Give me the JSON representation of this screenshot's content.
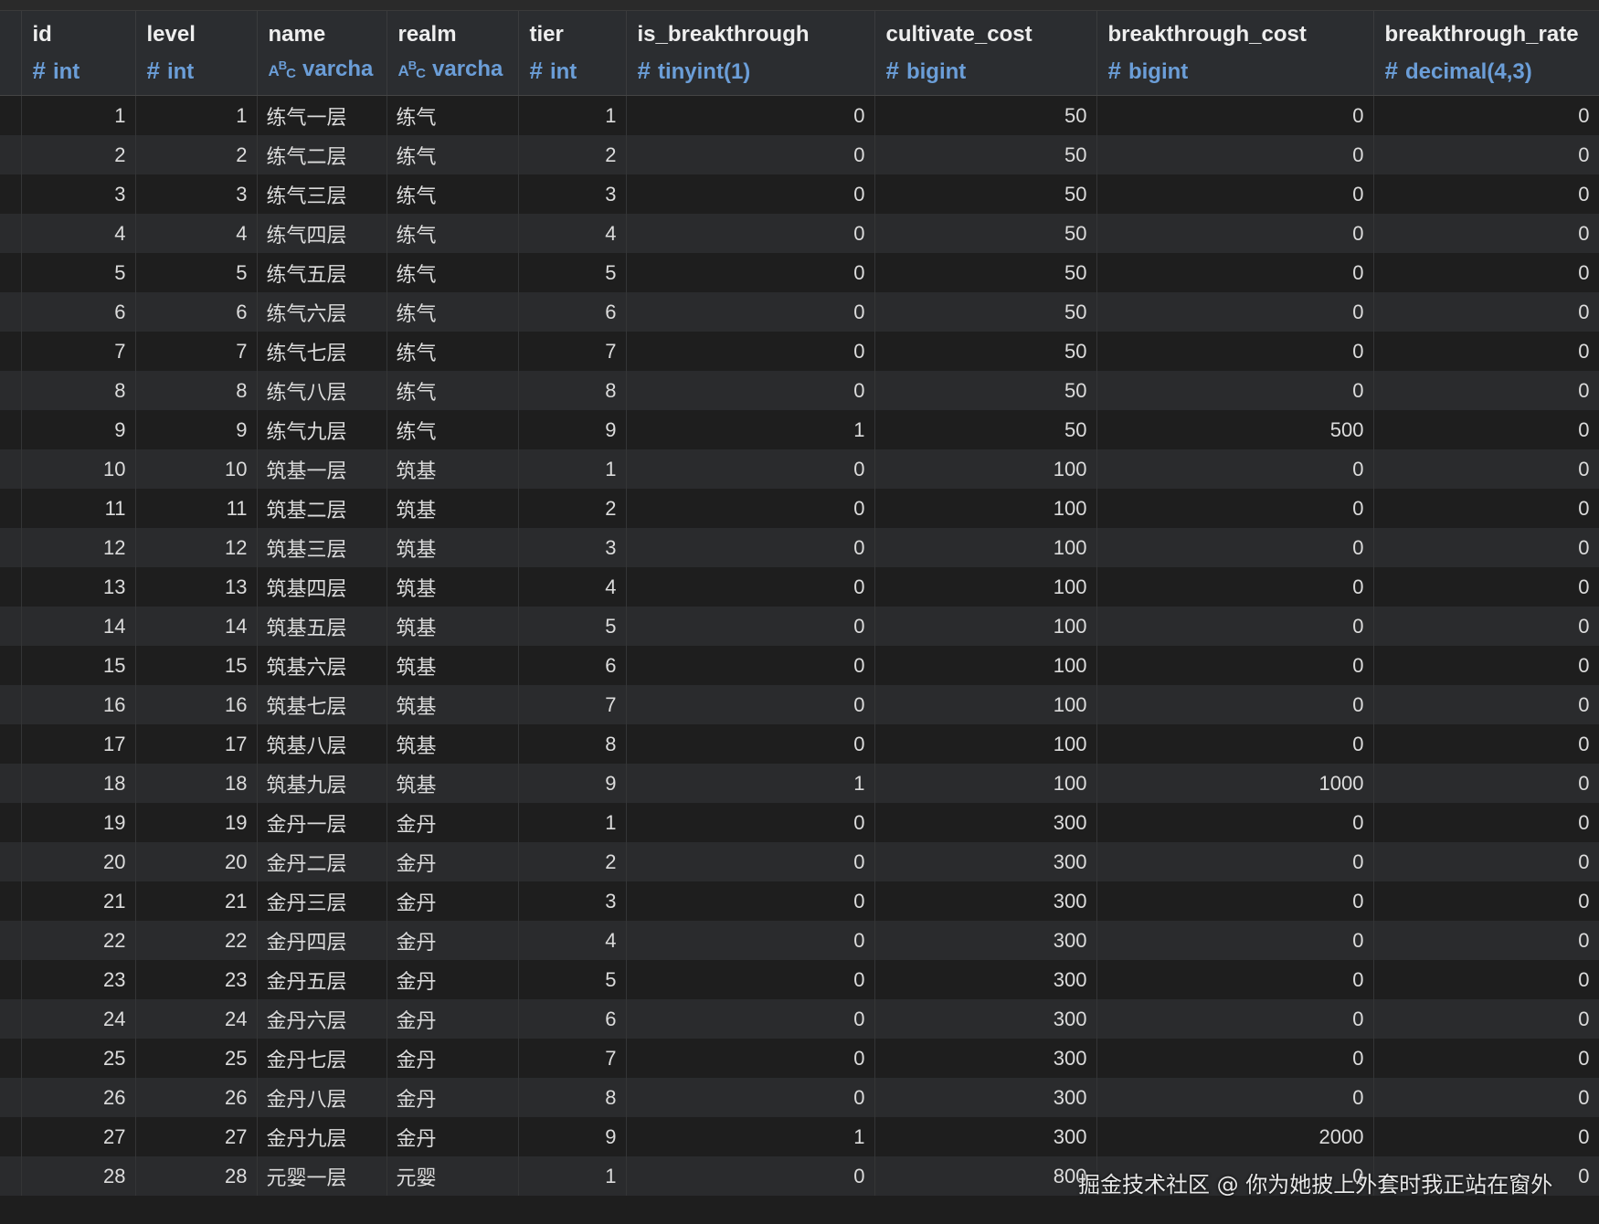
{
  "columns": [
    {
      "name": "id",
      "type": "int",
      "icon": "hash-icon"
    },
    {
      "name": "level",
      "type": "int",
      "icon": "hash-icon"
    },
    {
      "name": "name",
      "type": "varcha",
      "icon": "abc-icon"
    },
    {
      "name": "realm",
      "type": "varcha",
      "icon": "abc-icon"
    },
    {
      "name": "tier",
      "type": "int",
      "icon": "hash-icon"
    },
    {
      "name": "is_breakthrough",
      "type": "tinyint(1)",
      "icon": "hash-icon"
    },
    {
      "name": "cultivate_cost",
      "type": "bigint",
      "icon": "hash-icon"
    },
    {
      "name": "breakthrough_cost",
      "type": "bigint",
      "icon": "hash-icon"
    },
    {
      "name": "breakthrough_rate",
      "type": "decimal(4,3)",
      "icon": "hash-icon"
    }
  ],
  "rows": [
    [
      "1",
      "1",
      "练气一层",
      "练气",
      "1",
      "0",
      "50",
      "0",
      "0"
    ],
    [
      "2",
      "2",
      "练气二层",
      "练气",
      "2",
      "0",
      "50",
      "0",
      "0"
    ],
    [
      "3",
      "3",
      "练气三层",
      "练气",
      "3",
      "0",
      "50",
      "0",
      "0"
    ],
    [
      "4",
      "4",
      "练气四层",
      "练气",
      "4",
      "0",
      "50",
      "0",
      "0"
    ],
    [
      "5",
      "5",
      "练气五层",
      "练气",
      "5",
      "0",
      "50",
      "0",
      "0"
    ],
    [
      "6",
      "6",
      "练气六层",
      "练气",
      "6",
      "0",
      "50",
      "0",
      "0"
    ],
    [
      "7",
      "7",
      "练气七层",
      "练气",
      "7",
      "0",
      "50",
      "0",
      "0"
    ],
    [
      "8",
      "8",
      "练气八层",
      "练气",
      "8",
      "0",
      "50",
      "0",
      "0"
    ],
    [
      "9",
      "9",
      "练气九层",
      "练气",
      "9",
      "1",
      "50",
      "500",
      "0"
    ],
    [
      "10",
      "10",
      "筑基一层",
      "筑基",
      "1",
      "0",
      "100",
      "0",
      "0"
    ],
    [
      "11",
      "11",
      "筑基二层",
      "筑基",
      "2",
      "0",
      "100",
      "0",
      "0"
    ],
    [
      "12",
      "12",
      "筑基三层",
      "筑基",
      "3",
      "0",
      "100",
      "0",
      "0"
    ],
    [
      "13",
      "13",
      "筑基四层",
      "筑基",
      "4",
      "0",
      "100",
      "0",
      "0"
    ],
    [
      "14",
      "14",
      "筑基五层",
      "筑基",
      "5",
      "0",
      "100",
      "0",
      "0"
    ],
    [
      "15",
      "15",
      "筑基六层",
      "筑基",
      "6",
      "0",
      "100",
      "0",
      "0"
    ],
    [
      "16",
      "16",
      "筑基七层",
      "筑基",
      "7",
      "0",
      "100",
      "0",
      "0"
    ],
    [
      "17",
      "17",
      "筑基八层",
      "筑基",
      "8",
      "0",
      "100",
      "0",
      "0"
    ],
    [
      "18",
      "18",
      "筑基九层",
      "筑基",
      "9",
      "1",
      "100",
      "1000",
      "0"
    ],
    [
      "19",
      "19",
      "金丹一层",
      "金丹",
      "1",
      "0",
      "300",
      "0",
      "0"
    ],
    [
      "20",
      "20",
      "金丹二层",
      "金丹",
      "2",
      "0",
      "300",
      "0",
      "0"
    ],
    [
      "21",
      "21",
      "金丹三层",
      "金丹",
      "3",
      "0",
      "300",
      "0",
      "0"
    ],
    [
      "22",
      "22",
      "金丹四层",
      "金丹",
      "4",
      "0",
      "300",
      "0",
      "0"
    ],
    [
      "23",
      "23",
      "金丹五层",
      "金丹",
      "5",
      "0",
      "300",
      "0",
      "0"
    ],
    [
      "24",
      "24",
      "金丹六层",
      "金丹",
      "6",
      "0",
      "300",
      "0",
      "0"
    ],
    [
      "25",
      "25",
      "金丹七层",
      "金丹",
      "7",
      "0",
      "300",
      "0",
      "0"
    ],
    [
      "26",
      "26",
      "金丹八层",
      "金丹",
      "8",
      "0",
      "300",
      "0",
      "0"
    ],
    [
      "27",
      "27",
      "金丹九层",
      "金丹",
      "9",
      "1",
      "300",
      "2000",
      "0"
    ],
    [
      "28",
      "28",
      "元婴一层",
      "元婴",
      "1",
      "0",
      "800",
      "0",
      "0"
    ]
  ],
  "watermark": "掘金技术社区 @ 你为她披上外套时我正站在窗外",
  "colors": {
    "background": "#1e1e1e",
    "row_alt": "#2a2b2d",
    "header_bg": "#2b2d30",
    "type_accent": "#6b9ed8"
  }
}
